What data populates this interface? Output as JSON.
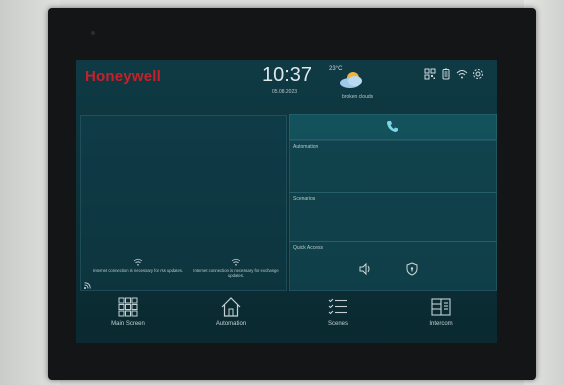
{
  "header": {
    "brand": "Honeywell",
    "time": "10:37",
    "date": "05.08.2023",
    "temperature": "23°C",
    "weather": "broken clouds",
    "status_icons": [
      "qr-code-icon",
      "battery-icon",
      "wifi-icon",
      "settings-icon"
    ]
  },
  "panels": {
    "call_icon": "phone-icon",
    "automation": "Automation",
    "scenarios": "Scenarios",
    "quick_access": "Quick Access",
    "quick_access_items": [
      "speaker-icon",
      "shield-icon"
    ]
  },
  "notices": [
    "Internet connection is necessary for rss updates.",
    "Internet connection is necessary for exchange updates."
  ],
  "nav": [
    {
      "label": "Main Screen",
      "icon": "grid-icon"
    },
    {
      "label": "Automation",
      "icon": "home-icon"
    },
    {
      "label": "Scenes",
      "icon": "checklist-icon"
    },
    {
      "label": "Intercom",
      "icon": "intercom-icon"
    }
  ],
  "colors": {
    "brand": "#c8202a",
    "screen_bg": "#0f3a44",
    "accent": "#7fd6e6"
  }
}
